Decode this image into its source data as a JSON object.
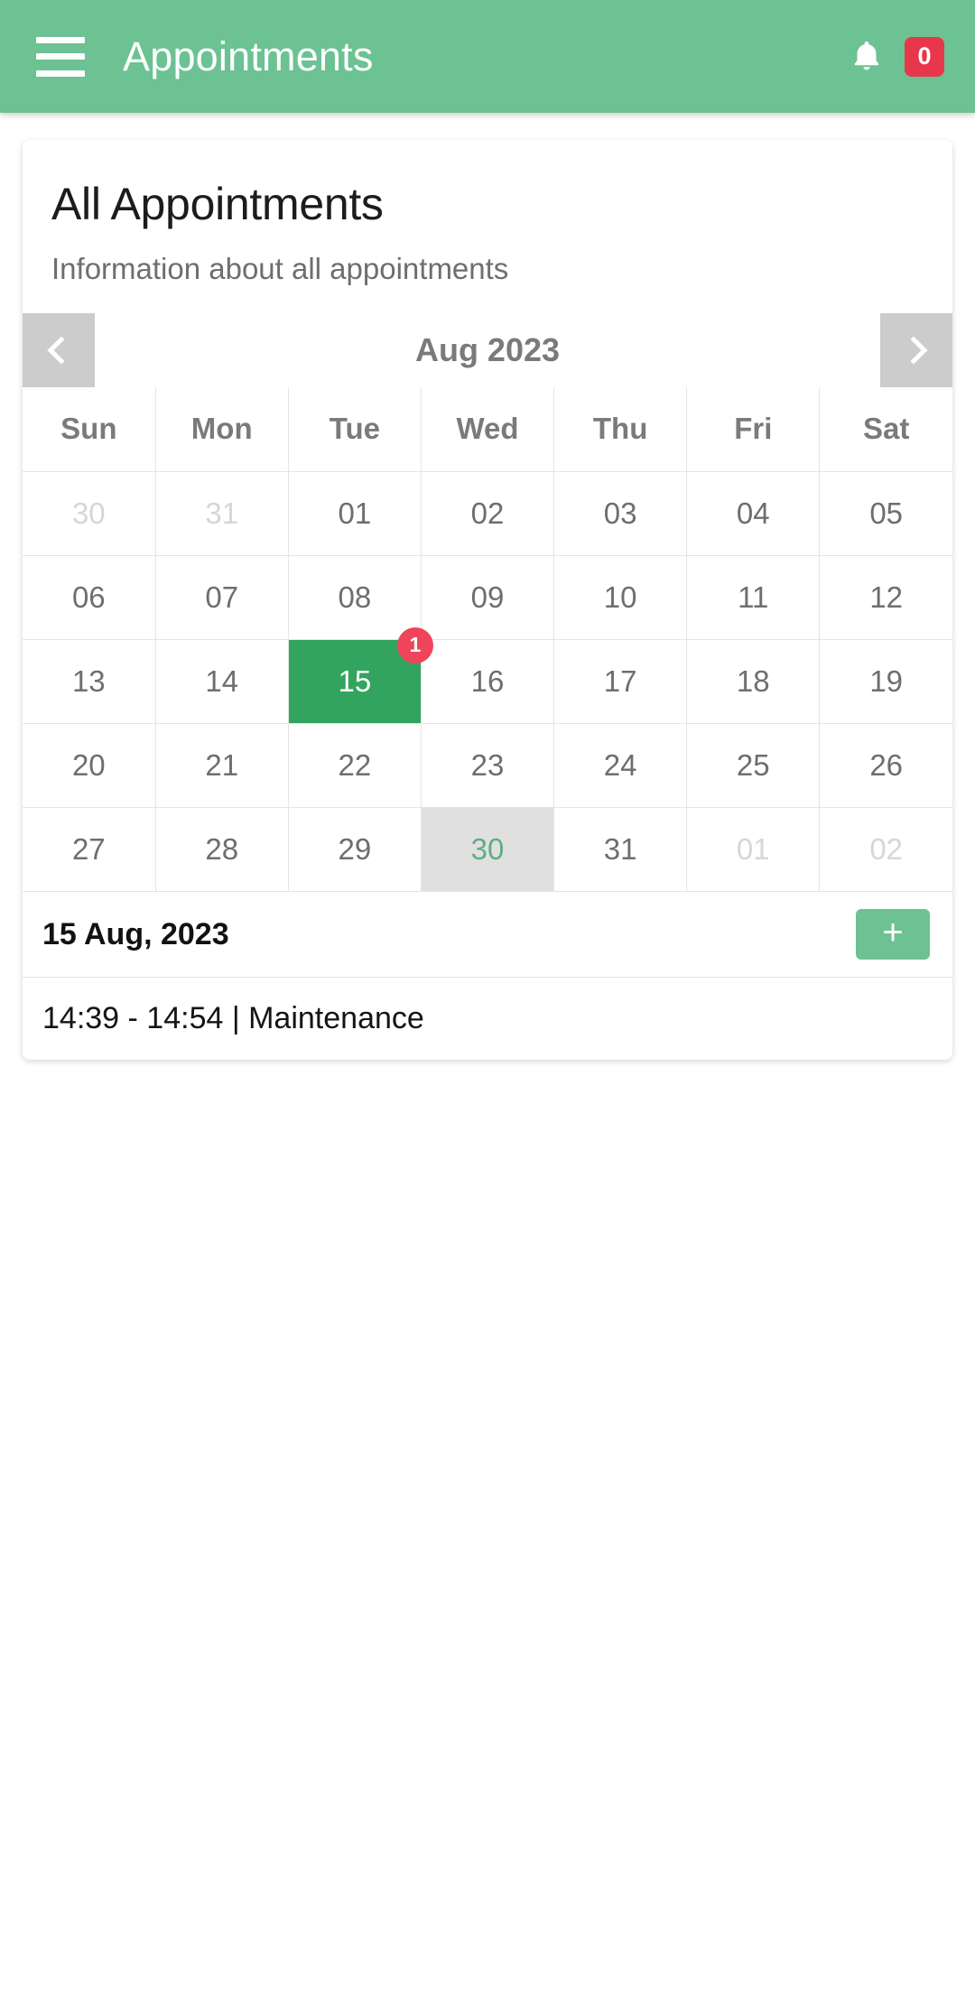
{
  "appbar": {
    "menu_icon": "hamburger-menu-icon",
    "title": "Appointments",
    "bell_icon": "bell-icon",
    "notification_count": "0",
    "background_color": "#6CC292",
    "badge_color": "#E8374A"
  },
  "card": {
    "title": "All Appointments",
    "subtitle": "Information about all appointments"
  },
  "calendar": {
    "prev_label": "‹",
    "next_label": "›",
    "month_label": "Aug 2023",
    "weekday_headers": [
      "Sun",
      "Mon",
      "Tue",
      "Wed",
      "Thu",
      "Fri",
      "Sat"
    ],
    "selected_color": "#33A45F",
    "today_color": "#E0E0E0",
    "badge_color": "#EF4459",
    "weeks": [
      [
        {
          "d": "30",
          "state": "out"
        },
        {
          "d": "31",
          "state": "out"
        },
        {
          "d": "01",
          "state": "normal"
        },
        {
          "d": "02",
          "state": "normal"
        },
        {
          "d": "03",
          "state": "normal"
        },
        {
          "d": "04",
          "state": "normal"
        },
        {
          "d": "05",
          "state": "normal"
        }
      ],
      [
        {
          "d": "06",
          "state": "normal"
        },
        {
          "d": "07",
          "state": "normal"
        },
        {
          "d": "08",
          "state": "normal"
        },
        {
          "d": "09",
          "state": "normal"
        },
        {
          "d": "10",
          "state": "normal"
        },
        {
          "d": "11",
          "state": "normal"
        },
        {
          "d": "12",
          "state": "normal"
        }
      ],
      [
        {
          "d": "13",
          "state": "normal"
        },
        {
          "d": "14",
          "state": "normal"
        },
        {
          "d": "15",
          "state": "sel",
          "badge": "1"
        },
        {
          "d": "16",
          "state": "normal"
        },
        {
          "d": "17",
          "state": "normal"
        },
        {
          "d": "18",
          "state": "normal"
        },
        {
          "d": "19",
          "state": "normal"
        }
      ],
      [
        {
          "d": "20",
          "state": "normal"
        },
        {
          "d": "21",
          "state": "normal"
        },
        {
          "d": "22",
          "state": "normal"
        },
        {
          "d": "23",
          "state": "normal"
        },
        {
          "d": "24",
          "state": "normal"
        },
        {
          "d": "25",
          "state": "normal"
        },
        {
          "d": "26",
          "state": "normal"
        }
      ],
      [
        {
          "d": "27",
          "state": "normal"
        },
        {
          "d": "28",
          "state": "normal"
        },
        {
          "d": "29",
          "state": "normal"
        },
        {
          "d": "30",
          "state": "today"
        },
        {
          "d": "31",
          "state": "normal"
        },
        {
          "d": "01",
          "state": "out"
        },
        {
          "d": "02",
          "state": "out"
        }
      ]
    ]
  },
  "selection": {
    "date_label": "15 Aug, 2023",
    "add_label": "+",
    "appointments": [
      {
        "text": "14:39 - 14:54 | Maintenance"
      }
    ]
  }
}
